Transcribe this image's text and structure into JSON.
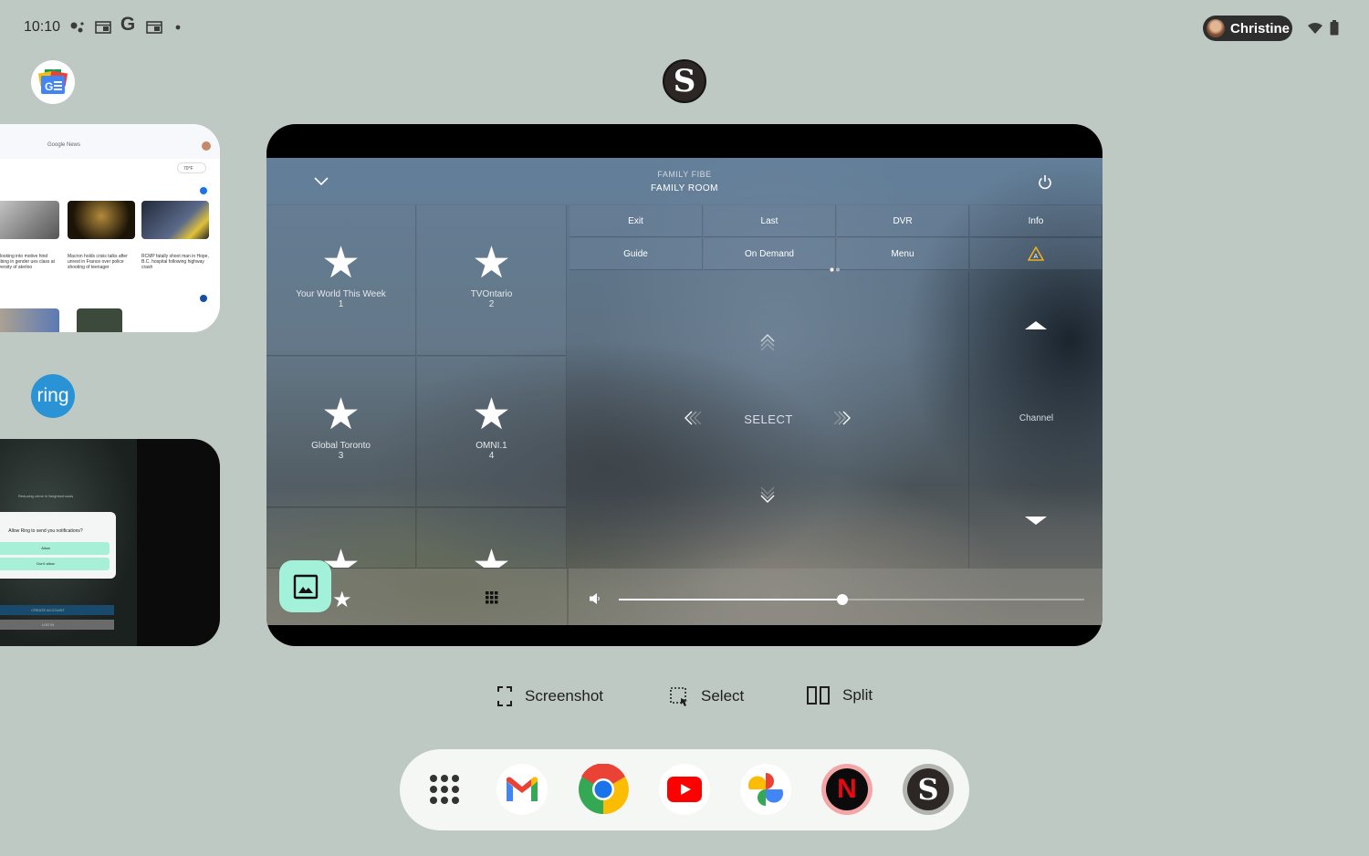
{
  "status_bar": {
    "time": "10:10",
    "notification_icons": [
      "assistant-dots-icon",
      "news-icon",
      "google-g-icon",
      "news-icon",
      "dot-icon"
    ],
    "user_name": "Christine",
    "system_icons": [
      "wifi-icon",
      "battery-icon"
    ]
  },
  "recents": {
    "google_news": {
      "badge_text": "G☰",
      "app_brand": "Google News",
      "weather": "70°F",
      "articles": [
        {
          "headline": "lice looking into motive hind stabbing in gender ues class at University of aterloo"
        },
        {
          "headline": "Macron holds crisis talks after unrest in France over police shooting of teenager"
        },
        {
          "headline": "RCMP fatally shoot man in Hope, B.C. hospital following highway crash"
        }
      ]
    },
    "ring": {
      "badge_text": "ring",
      "tagline": "Reducing crime in Neighborhoods",
      "dialog_title": "Allow Ring to send you notifications?",
      "allow_label": "Allow",
      "deny_label": "Don't allow",
      "create_account_label": "CREATE ACCOUNT",
      "login_label": "LOG IN"
    },
    "sling": {
      "badge_text": "S"
    }
  },
  "remote": {
    "provider": "FAMILY FIBE",
    "room": "FAMILY ROOM",
    "favorites": [
      {
        "name": "Your World This Week",
        "number": "1"
      },
      {
        "name": "TVOntario",
        "number": "2"
      },
      {
        "name": "Global Toronto",
        "number": "3"
      },
      {
        "name": "OMNI.1",
        "number": "4"
      }
    ],
    "keys_row1": [
      "Exit",
      "Last",
      "DVR",
      "Info"
    ],
    "keys_row2": [
      "Guide",
      "On Demand",
      "Menu"
    ],
    "select_label": "SELECT",
    "channel_label": "Channel",
    "volume_fraction": 0.48,
    "page_indicator": {
      "pages": 2,
      "current": 1
    }
  },
  "actions": {
    "screenshot_label": "Screenshot",
    "select_label": "Select",
    "split_label": "Split"
  },
  "dock": {
    "apps": [
      "App drawer",
      "Gmail",
      "Chrome",
      "YouTube",
      "Google Photos",
      "Netflix",
      "Sling TV"
    ]
  },
  "colors": {
    "background": "#bfc9c3",
    "photo_button": "#a2f1d8",
    "warning_yellow": "#e8b21c"
  }
}
